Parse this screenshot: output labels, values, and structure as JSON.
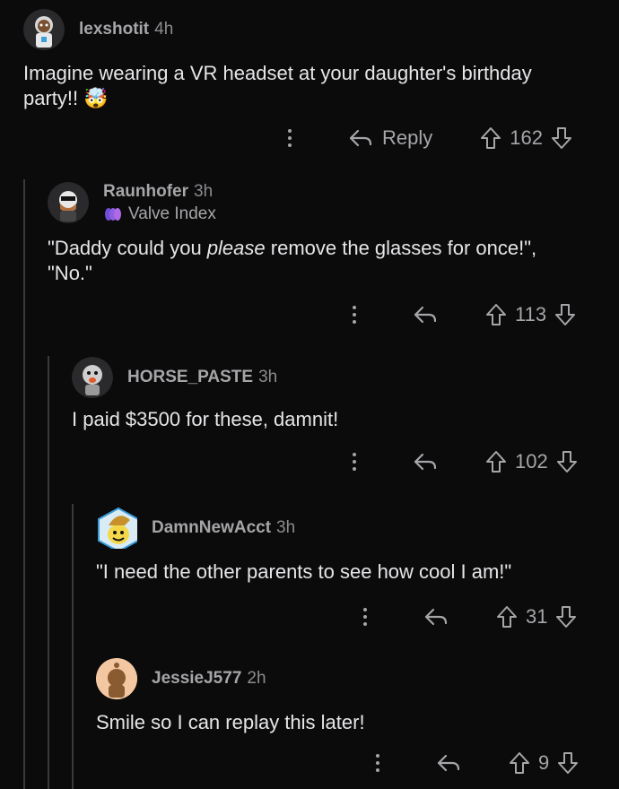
{
  "comments": [
    {
      "username": "lexshotit",
      "time": "4h",
      "body": "Imagine wearing a VR headset at your daughter's birthday party!! 🤯",
      "reply_label": "Reply",
      "score": "162"
    },
    {
      "username": "Raunhofer",
      "time": "3h",
      "flair": "Valve Index",
      "body_before": "\"Daddy could you ",
      "body_em": "please",
      "body_after": " remove the glasses for once!\", \"No.\"",
      "score": "113"
    },
    {
      "username": "HORSE_PASTE",
      "time": "3h",
      "body": "I paid $3500 for these, damnit!",
      "score": "102"
    },
    {
      "username": "DamnNewAcct",
      "time": "3h",
      "body": "\"I need the other parents to see how cool I am!\"",
      "score": "31"
    },
    {
      "username": "JessieJ577",
      "time": "2h",
      "body": "Smile so I can replay this later!",
      "score": "9"
    }
  ]
}
